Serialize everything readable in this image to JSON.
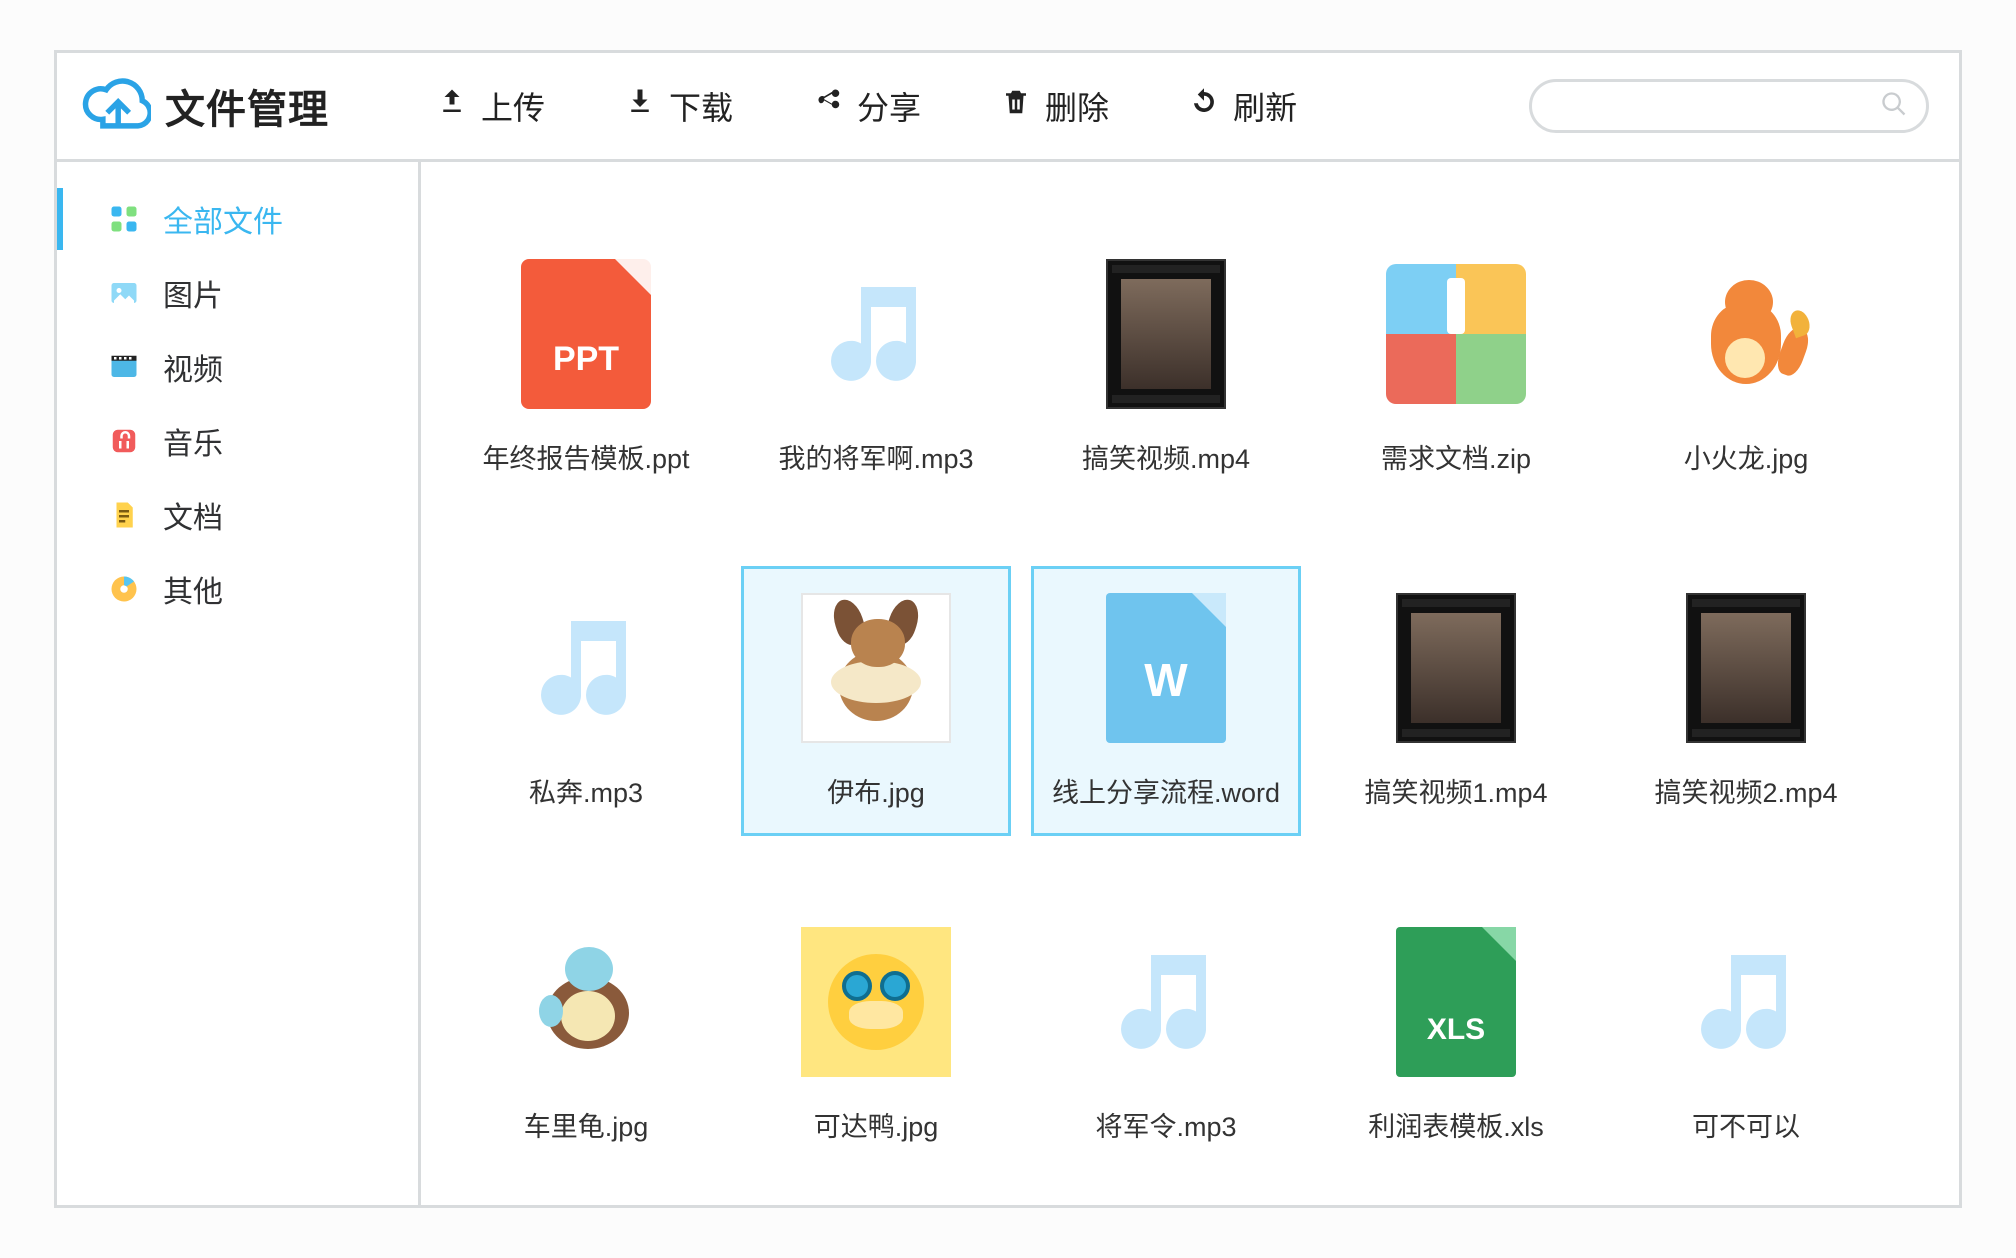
{
  "app": {
    "title": "文件管理"
  },
  "toolbar": {
    "upload": "上传",
    "download": "下载",
    "share": "分享",
    "delete": "删除",
    "refresh": "刷新"
  },
  "search": {
    "placeholder": ""
  },
  "sidebar": {
    "items": [
      {
        "key": "all",
        "label": "全部文件",
        "active": true
      },
      {
        "key": "image",
        "label": "图片",
        "active": false
      },
      {
        "key": "video",
        "label": "视频",
        "active": false
      },
      {
        "key": "music",
        "label": "音乐",
        "active": false
      },
      {
        "key": "doc",
        "label": "文档",
        "active": false
      },
      {
        "key": "other",
        "label": "其他",
        "active": false
      }
    ]
  },
  "files": [
    {
      "name": "年终报告模板.ppt",
      "type": "ppt",
      "selected": false
    },
    {
      "name": "我的将军啊.mp3",
      "type": "audio",
      "selected": false
    },
    {
      "name": "搞笑视频.mp4",
      "type": "video",
      "selected": false
    },
    {
      "name": "需求文档.zip",
      "type": "zip",
      "selected": false
    },
    {
      "name": "小火龙.jpg",
      "type": "image",
      "img": "charmander",
      "selected": false
    },
    {
      "name": "私奔.mp3",
      "type": "audio",
      "selected": false
    },
    {
      "name": "伊布.jpg",
      "type": "image",
      "img": "eevee",
      "selected": true
    },
    {
      "name": "线上分享流程.word",
      "type": "word",
      "selected": true
    },
    {
      "name": "搞笑视频1.mp4",
      "type": "video",
      "selected": false
    },
    {
      "name": "搞笑视频2.mp4",
      "type": "video",
      "selected": false
    },
    {
      "name": "车里龟.jpg",
      "type": "image",
      "img": "squirtle",
      "selected": false
    },
    {
      "name": "可达鸭.jpg",
      "type": "image",
      "img": "psyduck",
      "selected": false
    },
    {
      "name": "将军令.mp3",
      "type": "audio",
      "selected": false
    },
    {
      "name": "利润表模板.xls",
      "type": "xls",
      "selected": false
    },
    {
      "name": "可不可以",
      "type": "audio",
      "selected": false
    }
  ],
  "fileTypeLabels": {
    "ppt": "PPT",
    "word": "W",
    "xls": "XLS"
  },
  "colors": {
    "accent": "#3ab7f0"
  }
}
